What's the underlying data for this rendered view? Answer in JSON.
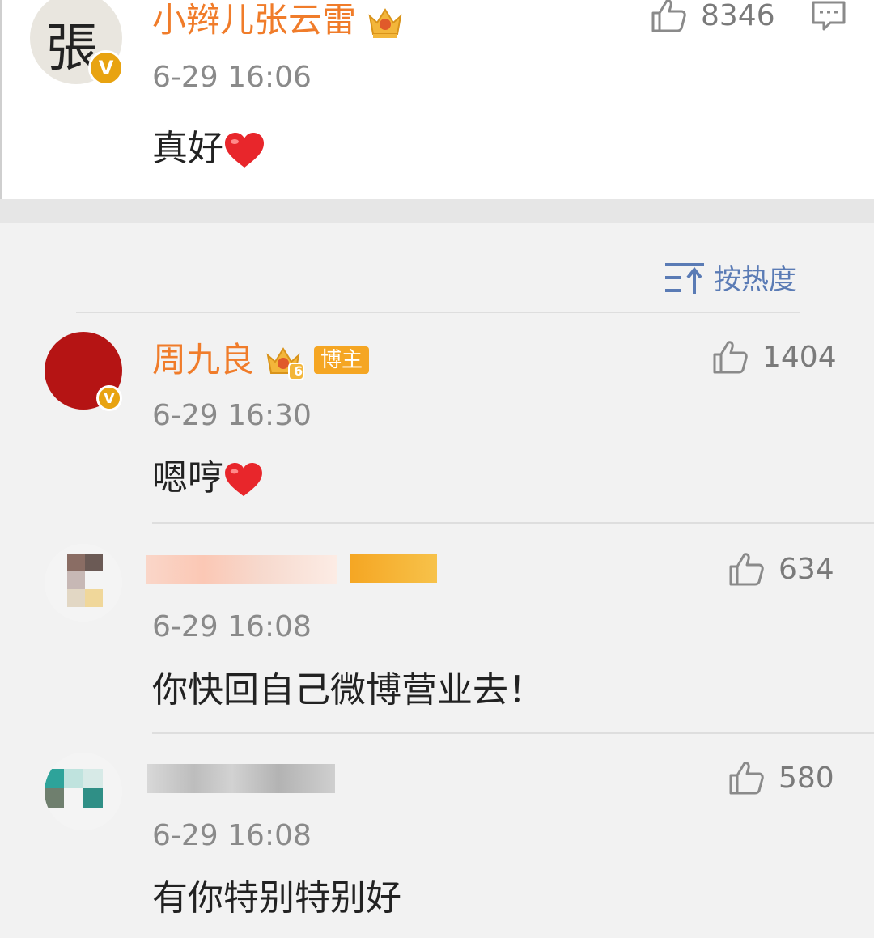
{
  "main_post": {
    "author": "小辫儿张云雷",
    "time": "6-29 16:06",
    "content": "真好",
    "likes": "8346",
    "avatar_glyph": "張",
    "verified_badge": "V"
  },
  "sort": {
    "label": "按热度"
  },
  "comments": [
    {
      "author": "周九良",
      "badge": "博主",
      "crown_level": "6",
      "time": "6-29 16:30",
      "content": "嗯哼",
      "likes": "1404",
      "verified_badge": "V"
    },
    {
      "author": "",
      "time": "6-29 16:08",
      "content": "你快回自己微博营业去！",
      "likes": "634"
    },
    {
      "author": "",
      "time": "6-29 16:08",
      "content": "有你特别特别好",
      "likes": "580"
    }
  ],
  "colors": {
    "name_orange": "#f07c2a",
    "time_gray": "#8a8a8a",
    "badge_orange": "#f5a623",
    "sort_blue": "#5a7bb5",
    "crown_gold": "#f3b63a"
  },
  "icons": [
    "thumbs-up-icon",
    "comment-icon",
    "crown-icon",
    "heart-icon",
    "sort-icon",
    "verified-icon"
  ]
}
